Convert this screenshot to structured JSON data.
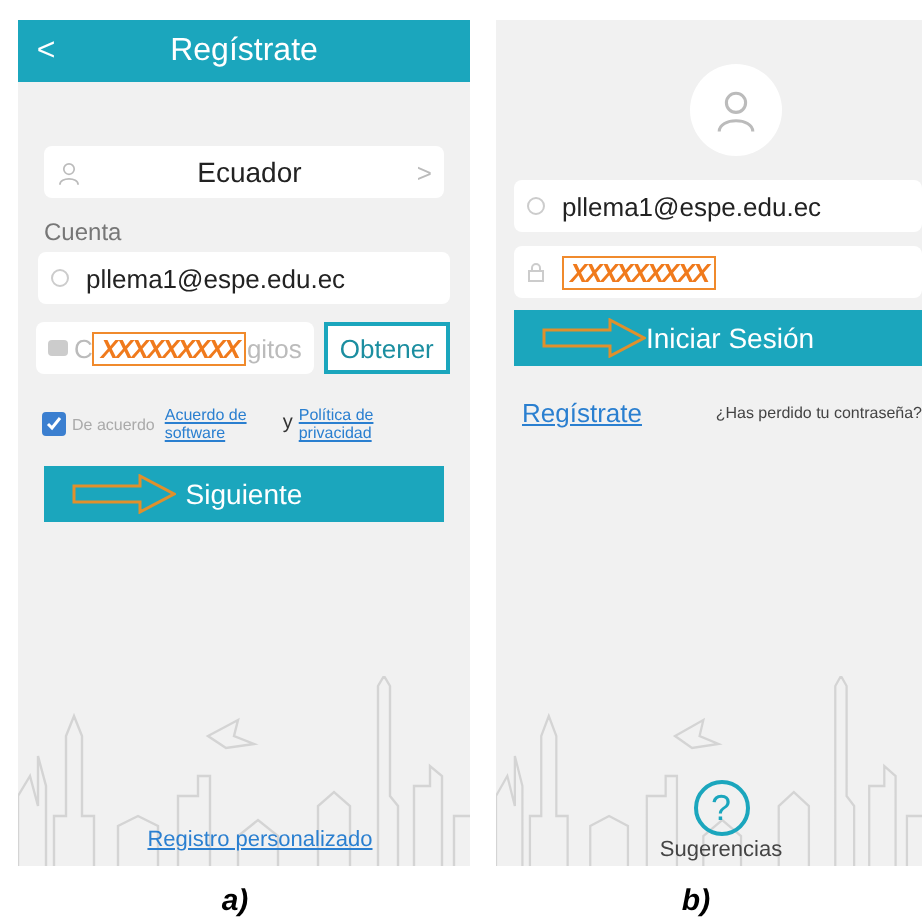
{
  "panels": [
    {
      "kind": "register",
      "caption": "a)",
      "header": {
        "back": "<",
        "title": "Regístrate"
      },
      "country": "Ecuador",
      "chevron": ">",
      "account_label": "Cuenta",
      "email": "pllema1@espe.edu.ec",
      "code_field": {
        "head": "C",
        "mask": "XXXXXXXXX",
        "tail": "gitos"
      },
      "get_code_button": "Obtener",
      "agreement": {
        "checked": true,
        "label": "De acuerdo",
        "link_1": "Acuerdo de software",
        "joiner": "y",
        "link_2": "Política de privacidad"
      },
      "next_button": "Siguiente",
      "footer_link": "Registro personalizado"
    },
    {
      "kind": "login",
      "caption": "b)",
      "email": "pllema1@espe.edu.ec",
      "password_mask": "XXXXXXXXX",
      "login_button": "Iniciar Sesión",
      "register_link": "Regístrate",
      "forgot_link": "¿Has perdido tu contraseña?",
      "help_icon": "?",
      "help_label": "Sugerencias"
    }
  ]
}
